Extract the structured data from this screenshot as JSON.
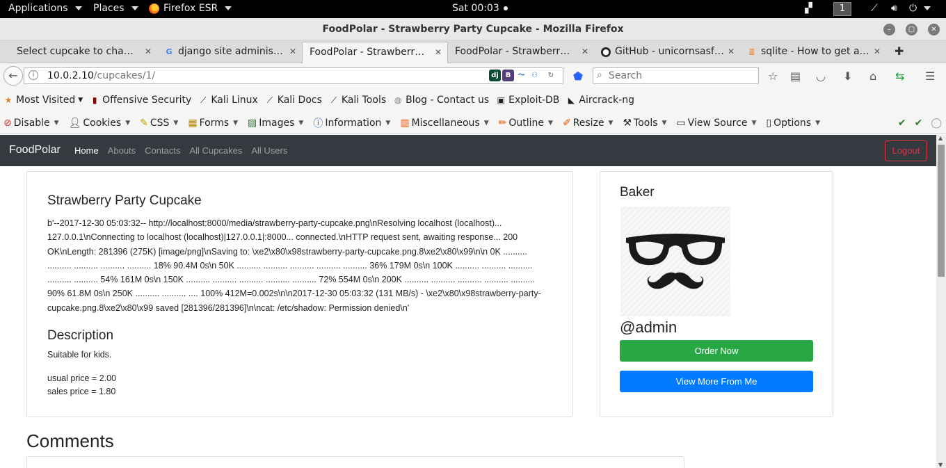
{
  "system_bar": {
    "applications": "Applications",
    "places": "Places",
    "browser_menu": "Firefox ESR",
    "clock": "Sat 00:03",
    "workspace": "1"
  },
  "window": {
    "title": "FoodPolar - Strawberry Party Cupcake - Mozilla Firefox"
  },
  "tabs": [
    {
      "label": "Select cupcake to chang...",
      "favicon": "django-icon"
    },
    {
      "label": "django site administra...",
      "favicon": "google-icon"
    },
    {
      "label": "FoodPolar - Strawberry P...",
      "favicon": "none"
    },
    {
      "label": "FoodPolar - Strawberry P...",
      "favicon": "none"
    },
    {
      "label": "GitHub - unicornsasfu...",
      "favicon": "github-icon"
    },
    {
      "label": "sqlite - How to get a l...",
      "favicon": "stackoverflow-icon"
    }
  ],
  "navbar": {
    "url_host": "10.0.2.10",
    "url_path": "/cupcakes/1/",
    "search_placeholder": "Search"
  },
  "bookmarks": [
    {
      "label": "Most Visited",
      "icon": "star-folder-icon"
    },
    {
      "label": "Offensive Security",
      "icon": "offsec-icon"
    },
    {
      "label": "Kali Linux",
      "icon": "kali-dragon-icon"
    },
    {
      "label": "Kali Docs",
      "icon": "kali-dragon-icon"
    },
    {
      "label": "Kali Tools",
      "icon": "kali-dragon-icon"
    },
    {
      "label": "Blog - Contact us",
      "icon": "globe-icon"
    },
    {
      "label": "Exploit-DB",
      "icon": "exploitdb-icon"
    },
    {
      "label": "Aircrack-ng",
      "icon": "aircrack-icon"
    }
  ],
  "devtoolbar": [
    {
      "label": "Disable",
      "icon": "block-icon"
    },
    {
      "label": "Cookies",
      "icon": "person-icon"
    },
    {
      "label": "CSS",
      "icon": "pen-icon"
    },
    {
      "label": "Forms",
      "icon": "form-icon"
    },
    {
      "label": "Images",
      "icon": "image-icon"
    },
    {
      "label": "Information",
      "icon": "info-icon"
    },
    {
      "label": "Miscellaneous",
      "icon": "folder-icon"
    },
    {
      "label": "Outline",
      "icon": "pencil-icon"
    },
    {
      "label": "Resize",
      "icon": "ruler-icon"
    },
    {
      "label": "Tools",
      "icon": "tools-icon"
    },
    {
      "label": "View Source",
      "icon": "source-icon"
    },
    {
      "label": "Options",
      "icon": "options-icon"
    }
  ],
  "site": {
    "brand": "FoodPolar",
    "nav": [
      "Home",
      "Abouts",
      "Contacts",
      "All Cupcakes",
      "All Users"
    ],
    "logout": "Logout"
  },
  "cupcake": {
    "name": "Strawberry Party Cupcake",
    "output": "b'--2017-12-30 05:03:32-- http://localhost:8000/media/strawberry-party-cupcake.png\\nResolving localhost (localhost)... 127.0.0.1\\nConnecting to localhost (localhost)|127.0.0.1|:8000... connected.\\nHTTP request sent, awaiting response... 200 OK\\nLength: 281396 (275K) [image/png]\\nSaving to: \\xe2\\x80\\x98strawberry-party-cupcake.png.8\\xe2\\x80\\x99\\n\\n 0K .......... .......... .......... .......... .......... 18% 90.4M 0s\\n 50K .......... .......... .......... .......... .......... 36% 179M 0s\\n 100K .......... .......... .......... .......... .......... 54% 161M 0s\\n 150K .......... .......... .......... .......... .......... 72% 554M 0s\\n 200K .......... .......... .......... .......... .......... 90% 61.8M 0s\\n 250K .......... .......... .... 100% 412M=0.002s\\n\\n2017-12-30 05:03:32 (131 MB/s) - \\xe2\\x80\\x98strawberry-party-cupcake.png.8\\xe2\\x80\\x99 saved [281396/281396]\\n\\ncat: /etc/shadow: Permission denied\\n'",
    "description_heading": "Description",
    "description": "Suitable for kids.",
    "usual_price": "usual price = 2.00",
    "sales_price": "sales price = 1.80"
  },
  "baker": {
    "heading": "Baker",
    "handle": "@admin",
    "order_button": "Order Now",
    "more_button": "View More From Me"
  },
  "comments": {
    "heading": "Comments"
  }
}
